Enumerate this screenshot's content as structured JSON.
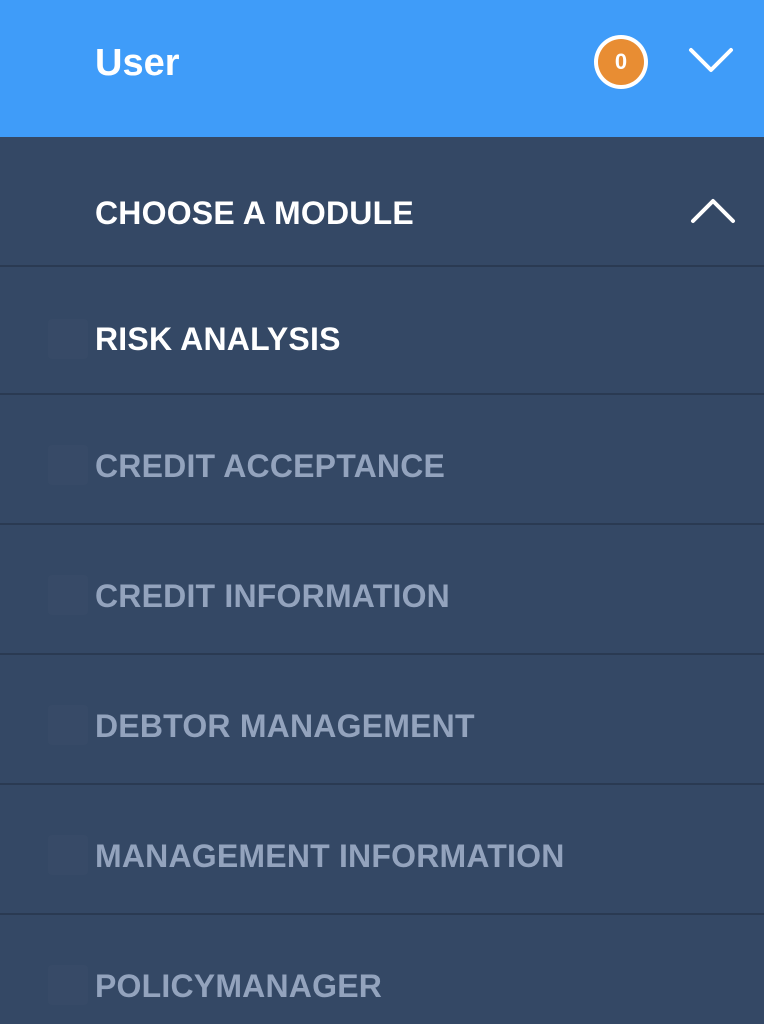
{
  "header": {
    "title": "User",
    "notification_count": "0"
  },
  "menu": {
    "section_title": "CHOOSE A MODULE",
    "items": [
      {
        "label": "RISK ANALYSIS",
        "active": true
      },
      {
        "label": "CREDIT ACCEPTANCE",
        "active": false
      },
      {
        "label": "CREDIT INFORMATION",
        "active": false
      },
      {
        "label": "DEBTOR MANAGEMENT",
        "active": false
      },
      {
        "label": "MANAGEMENT INFORMATION",
        "active": false
      },
      {
        "label": "POLICYMANAGER",
        "active": false
      }
    ]
  },
  "colors": {
    "header_bg": "#3f9cf9",
    "menu_bg": "#344865",
    "badge": "#e88d33",
    "label_active": "#ffffff",
    "label_inactive": "#93a3bd"
  },
  "icons": {
    "header_toggle": "chevron-down-icon",
    "section_toggle": "chevron-up-icon"
  }
}
